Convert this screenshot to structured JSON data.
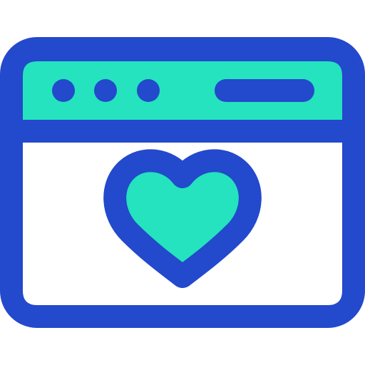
{
  "icon": {
    "name": "browser-window-heart-icon",
    "colors": {
      "outline": "#2349CC",
      "accent": "#24E3BE",
      "background": "#FFFFFF"
    }
  }
}
